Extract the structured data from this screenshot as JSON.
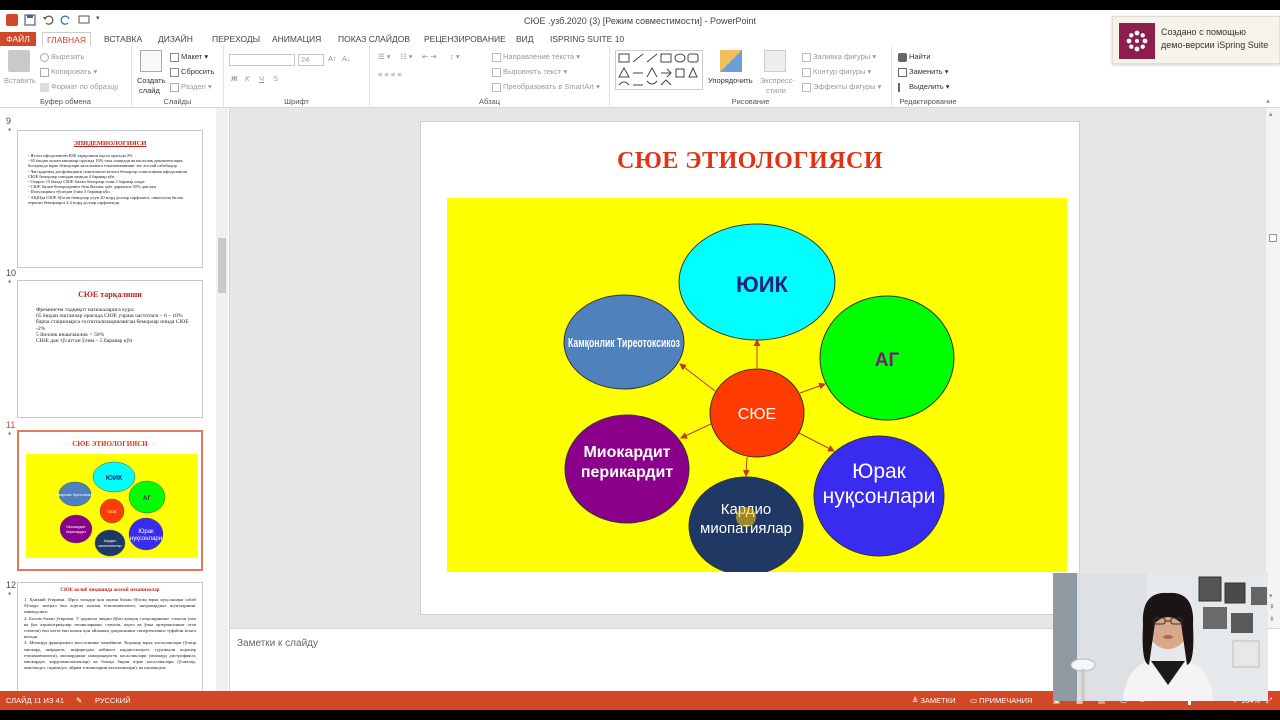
{
  "window": {
    "title": "СЮЕ .узб.2020 (3) [Режим совместимости] - PowerPoint"
  },
  "tabs": [
    {
      "label": "ФАЙЛ"
    },
    {
      "label": "ГЛАВНАЯ"
    },
    {
      "label": "ВСТАВКА"
    },
    {
      "label": "ДИЗАЙН"
    },
    {
      "label": "ПЕРЕХОДЫ"
    },
    {
      "label": "АНИМАЦИЯ"
    },
    {
      "label": "ПОКАЗ СЛАЙДОВ"
    },
    {
      "label": "РЕЦЕНЗИРОВАНИЕ"
    },
    {
      "label": "ВИД"
    },
    {
      "label": "ISPRING SUITE 10"
    }
  ],
  "ribbon": {
    "clipboard": {
      "paste": "Вставить",
      "cut": "Вырезать",
      "copy": "Копировать",
      "format_painter": "Формат по образцу",
      "label": "Буфер обмена"
    },
    "slides": {
      "new_slide_1": "Создать",
      "new_slide_2": "слайд",
      "layout": "Макет",
      "reset": "Сбросить",
      "section": "Раздел",
      "label": "Слайды"
    },
    "font": {
      "size": "24",
      "bold": "Ж",
      "italic": "К",
      "underline": "Ч",
      "strike": "S",
      "label": "Шрифт"
    },
    "paragraph": {
      "text_direction": "Направление текста",
      "align_text": "Выровнять текст",
      "smartart": "Преобразовать в SmartArt",
      "label": "Абзац"
    },
    "drawing": {
      "arrange": "Упорядочить",
      "quick_styles_1": "Экспресс-",
      "quick_styles_2": "стили",
      "shape_fill": "Заливка фигуры",
      "shape_outline": "Контур фигуры",
      "shape_effects": "Эффекты фигуры",
      "label": "Рисование"
    },
    "editing": {
      "find": "Найти",
      "replace": "Заменить",
      "select": "Выделить",
      "label": "Редактирование"
    }
  },
  "toast": {
    "line1": "Создано с помощью",
    "line2": "демо-версии iSpring Suite"
  },
  "thumbnails": [
    {
      "num": "9",
      "title": "ЭПИДЕМИОЛОГИЯСИ",
      "lines": [
        "- Яхлол ифодалангнн ЮК тарқалиши аҳоли орасида 2%",
        "- 65 ёшдан ошган кишилар орасида 10% гача оширади ва касаллик декомпенсация босқичида юрак беморлари касалхонага етказилишининг энг асосий сабабидир",
        "- Чап қоринча дисфункцияси симптомсиз кечган беморлар сони клиник ифодаланган СЮЕ беморлар сонидан камида 4 баравар кўп",
        "- Охирги 15 йилда СЮЕ билан беморлар сони 3 баравар ошди",
        "- СЮЕ билан беморларнинг беш йиллик ҳаёт даражаси 50% дан кам",
        "- Популяцияга тўсатдан ўлим 5 баравар кўп",
        "- АҚШда СЮЕ бўлган беморлар учун 20 млрд доллар сарфланса, онкология билан оғриган беморларга 2,4 млрд доллар сарфланади."
      ]
    },
    {
      "num": "10",
      "title": "СЮЕ тарқалиши",
      "lines": [
        "Фремингем тадқиқот натижаларига кура:",
        "65 ёшдан ошганлар орасида СЮЕ учраш частотаси – 6 – 10%",
        "барча стационарга госпитализацияланган беморлар ичида СЮЕ -2%",
        "5 йиллик янашчанлик < 50%",
        "СЮЕ дан тўсаттан ўлим – 5 баравар кўп"
      ]
    },
    {
      "num": "11",
      "title": "СЮЕ ЭТИОЛОГИЯСИ"
    },
    {
      "num": "12",
      "title": "СЮЕ келиб чиқишида асосий механизмлар",
      "lines": [
        "1. Ҳажмий ўтирими. Зўрга тасқари қон оқими билан бўлган юрак нуқсонлари сабаб бўлади: митрал ёки аортал клапан етишмовчилиги, интракардиал шунтларнинг мавжудлиги",
        "2. Босим билан ўтирими. У қоринча чиқиш йўли қопқоқ тасқилирининг стенози (чап ва ўнг атрионтрикуляр тешикларнинг стенози, аорта ва ўпка артериясининг оғзи стенози) ёки катта ёки кичик қон айланиш доирасининг гипертензияси туфайли юзага келади",
        "3. Миокард функционал массасининг камайиши. Коронар юрак касалликлари (ўткир миокард инфаркти, инфарктдан кейинги кардиосклероз, сурункали коронар етишмовчилиги), миокарднинг нокоронароген касалликлари (миокард дистрофияси, миокардит, кардиомиопатиялар) ва бошқа бирон юрак касалликлари (ўсмалар, амилоидоз, саркоидоз, айрим токсикпарни касалликлари), ва шунингдек"
      ]
    }
  ],
  "slide": {
    "title": "СЮЕ ЭТИОЛОГИЯСИ",
    "center": "СЮЕ",
    "nodes": {
      "yuik": "ЮИК",
      "ag": "АГ",
      "kamkonlik": "Камқонлик Тиреотоксикоз",
      "miokardit_1": "Миокардит",
      "miokardit_2": "перикардит",
      "kardio_1": "Кардио",
      "kardio_2": "миопатиялар",
      "yurak_1": "Юрак",
      "yurak_2": "нуқсонлари"
    },
    "colors": {
      "background": "#ffff00",
      "title": "#e23214",
      "center": "#ff3c00",
      "yuik": "#00ffff",
      "ag": "#00ff00",
      "kamkonlik": "#4f81bd",
      "miokardit": "#8b008b",
      "kardio": "#1f3864",
      "yurak": "#3a2bf0",
      "arrow": "#c0392b"
    }
  },
  "notes": {
    "placeholder": "Заметки к слайду"
  },
  "status": {
    "slide_of": "СЛАЙД 11 ИЗ 41",
    "language": "РУССКИЙ",
    "notes": "ЗАМЕТКИ",
    "comments": "ПРИМЕЧАНИЯ",
    "zoom": "104%"
  }
}
